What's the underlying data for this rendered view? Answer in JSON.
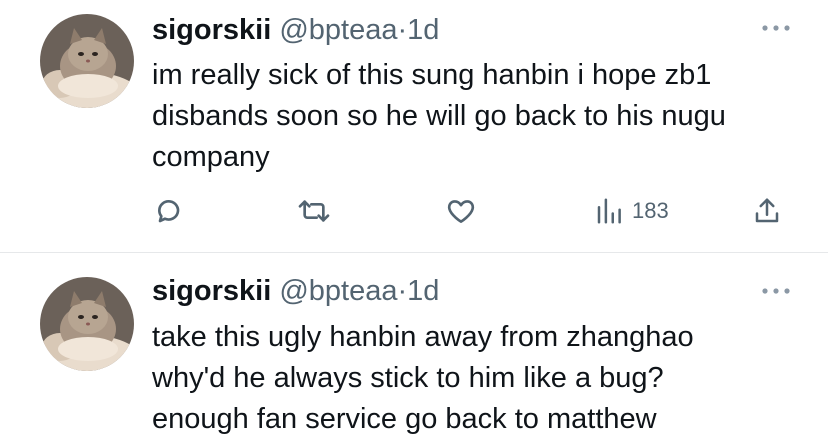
{
  "tweets": [
    {
      "display_name": "sigorskii",
      "handle": "@bpteaa",
      "separator": "·",
      "time": "1d",
      "text_lines": [
        "im really sick of this sung hanbin i hope zb1",
        "disbands soon so he will go back to his nugu",
        "company"
      ],
      "views": "183"
    },
    {
      "display_name": "sigorskii",
      "handle": "@bpteaa",
      "separator": "·",
      "time": "1d",
      "text_lines": [
        "take this ugly hanbin away from zhanghao",
        "why'd he always stick to him like a bug?",
        "enough fan service go back to matthew"
      ]
    }
  ],
  "icons": {
    "more": "more-dots-icon",
    "reply": "reply-icon",
    "retweet": "retweet-icon",
    "like": "heart-icon",
    "views": "views-bar-chart-icon",
    "share": "share-icon"
  },
  "colors": {
    "text": "#0f1419",
    "secondary": "#536471",
    "divider": "#e6e8ea"
  }
}
